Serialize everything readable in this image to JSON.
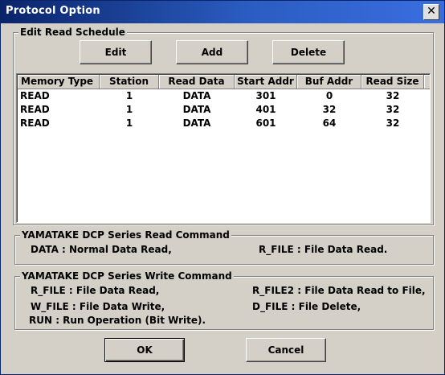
{
  "window": {
    "title": "Protocol Option",
    "close_glyph": "✕"
  },
  "schedule": {
    "group_title": "Edit Read Schedule",
    "edit_label": "Edit",
    "add_label": "Add",
    "delete_label": "Delete",
    "columns": [
      "Memory Type",
      "Station",
      "Read Data",
      "Start Addr",
      "Buf Addr",
      "Read Size"
    ],
    "rows": [
      [
        "READ",
        "1",
        "DATA",
        "301",
        "0",
        "32"
      ],
      [
        "READ",
        "1",
        "DATA",
        "401",
        "32",
        "32"
      ],
      [
        "READ",
        "1",
        "DATA",
        "601",
        "64",
        "32"
      ]
    ]
  },
  "read_cmd": {
    "title": "YAMATAKE DCP Series Read Command",
    "data_desc": "DATA : Normal Data Read,",
    "rfile_desc": "R_FILE : File Data Read."
  },
  "write_cmd": {
    "title": "YAMATAKE DCP Series Write Command",
    "rfile_desc": "R_FILE : File Data Read,",
    "rfile2_desc": "R_FILE2 : File Data Read to File,",
    "wfile_desc": "W_FILE : File Data Write,",
    "dfile_desc": "D_FILE : File Delete,",
    "run_desc": "RUN : Run Operation (Bit Write)."
  },
  "footer": {
    "ok_label": "OK",
    "cancel_label": "Cancel"
  }
}
